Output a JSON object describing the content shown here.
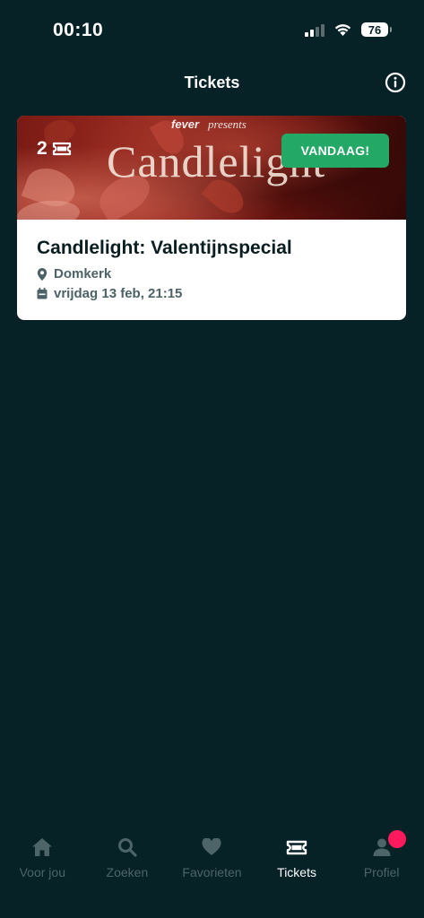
{
  "status_bar": {
    "time": "00:10",
    "battery": "76"
  },
  "header": {
    "title": "Tickets"
  },
  "ticket": {
    "banner_brand": "fever",
    "banner_presents": "presents",
    "banner_logo": "Candlelight",
    "ticket_count": "2",
    "badge": "VANDAAG!",
    "title": "Candlelight: Valentijnspecial",
    "location": "Domkerk",
    "datetime": "vrijdag 13 feb, 21:15"
  },
  "colors": {
    "background": "#062227",
    "badge": "#24a865",
    "notification": "#ff1a5e",
    "inactive_tab": "#4d6468"
  },
  "tabs": [
    {
      "label": "Voor jou",
      "icon": "home-icon",
      "active": false
    },
    {
      "label": "Zoeken",
      "icon": "search-icon",
      "active": false
    },
    {
      "label": "Favorieten",
      "icon": "heart-icon",
      "active": false
    },
    {
      "label": "Tickets",
      "icon": "ticket-icon",
      "active": true
    },
    {
      "label": "Profiel",
      "icon": "profile-icon",
      "active": false
    }
  ]
}
